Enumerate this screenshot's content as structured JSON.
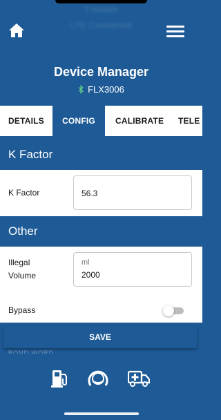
{
  "status": {
    "line1": "T-Mobile",
    "line2": "LTE Connected"
  },
  "header": {
    "title": "Device Manager",
    "device_name": "FLX3006"
  },
  "tabs": [
    {
      "label": "DETAILS",
      "active": false
    },
    {
      "label": "CONFIG",
      "active": true
    },
    {
      "label": "CALIBRATE",
      "active": false
    },
    {
      "label": "TELE",
      "active": false
    }
  ],
  "k_factor_section": {
    "title": "K Factor",
    "field_label": "K Factor",
    "value": "56.3"
  },
  "other_section": {
    "title": "Other",
    "illegal_volume_label_1": "Illegal",
    "illegal_volume_label_2": "Volume",
    "illegal_volume_unit": "ml",
    "illegal_volume_value": "2000",
    "bypass_label": "Bypass",
    "bypass_on": false
  },
  "save_label": "SAVE",
  "peek_text": "BOND WORD",
  "nav_icons": [
    "fuel-pump-icon",
    "gauge-icon",
    "truck-medical-icon"
  ],
  "colors": {
    "primary": "#1e5a96",
    "surface": "#ffffff",
    "toggle_track": "#bdbdbd"
  }
}
